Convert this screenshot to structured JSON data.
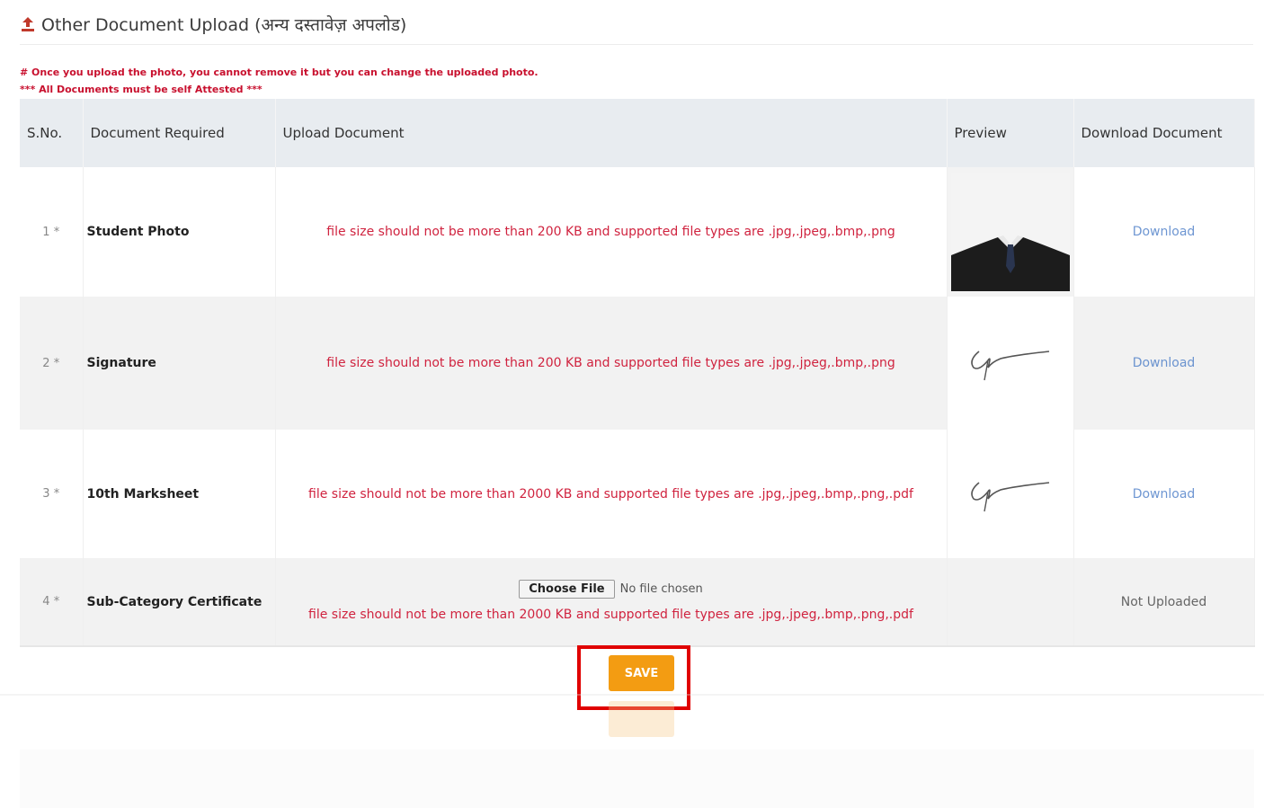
{
  "header": {
    "title": "Other Document Upload (अन्य दस्तावेज़ अपलोड)",
    "icon": "upload-icon"
  },
  "notes": {
    "line1": "# Once you upload the photo, you cannot remove it but you can change the uploaded photo.",
    "line2": "*** All Documents must be self Attested ***"
  },
  "table": {
    "headers": [
      "S.No.",
      "Document Required",
      "Upload Document",
      "Preview",
      "Download Document"
    ],
    "rows": [
      {
        "sno": "1 *",
        "doc": "Student Photo",
        "upload_note": "file size should not be more than 200 KB and supported file types are .jpg,.jpeg,.bmp,.png",
        "preview": "photo",
        "download": "Download"
      },
      {
        "sno": "2 *",
        "doc": "Signature",
        "upload_note": "file size should not be more than 200 KB and supported file types are .jpg,.jpeg,.bmp,.png",
        "preview": "signature",
        "download": "Download"
      },
      {
        "sno": "3 *",
        "doc": "10th Marksheet",
        "upload_note": "file size should not be more than 2000 KB and supported file types are .jpg,.jpeg,.bmp,.png,.pdf",
        "preview": "signature",
        "download": "Download"
      },
      {
        "sno": "4 *",
        "doc": "Sub-Category Certificate",
        "upload_note": "file size should not be more than 2000 KB and supported file types are .jpg,.jpeg,.bmp,.png,.pdf",
        "choose_label": "Choose File",
        "no_file": "No file chosen",
        "preview": "",
        "download": "Not Uploaded"
      }
    ]
  },
  "save_label": "SAVE",
  "colors": {
    "accent": "#f39c12",
    "warning_text": "#d0233f",
    "highlight": "#e00000",
    "link": "#4a7cc7"
  }
}
